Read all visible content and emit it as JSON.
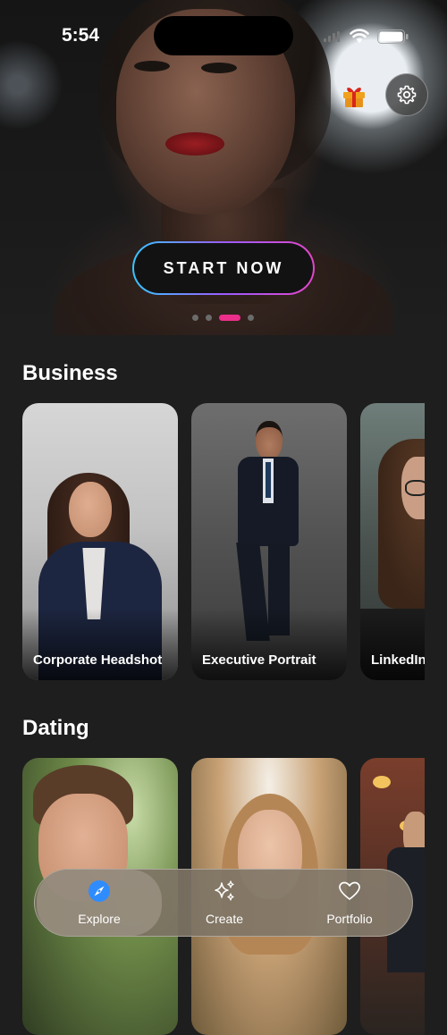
{
  "status_bar": {
    "time": "5:54"
  },
  "hero": {
    "cta_label": "START NOW",
    "carousel": {
      "count": 4,
      "active_index": 2
    }
  },
  "sections": [
    {
      "title": "Business",
      "cards": [
        {
          "label": "Corporate Headshot"
        },
        {
          "label": "Executive Portrait"
        },
        {
          "label": "LinkedIn"
        }
      ]
    },
    {
      "title": "Dating",
      "cards": [
        {
          "label": ""
        },
        {
          "label": ""
        },
        {
          "label": ""
        }
      ]
    }
  ],
  "nav": {
    "items": [
      {
        "label": "Explore",
        "icon": "compass-icon",
        "active": true
      },
      {
        "label": "Create",
        "icon": "sparkles-icon",
        "active": false
      },
      {
        "label": "Portfolio",
        "icon": "heart-icon",
        "active": false
      }
    ]
  },
  "colors": {
    "accent_pink": "#ec2f8a",
    "accent_blue": "#2f8cff",
    "background": "#1e1e1e"
  }
}
